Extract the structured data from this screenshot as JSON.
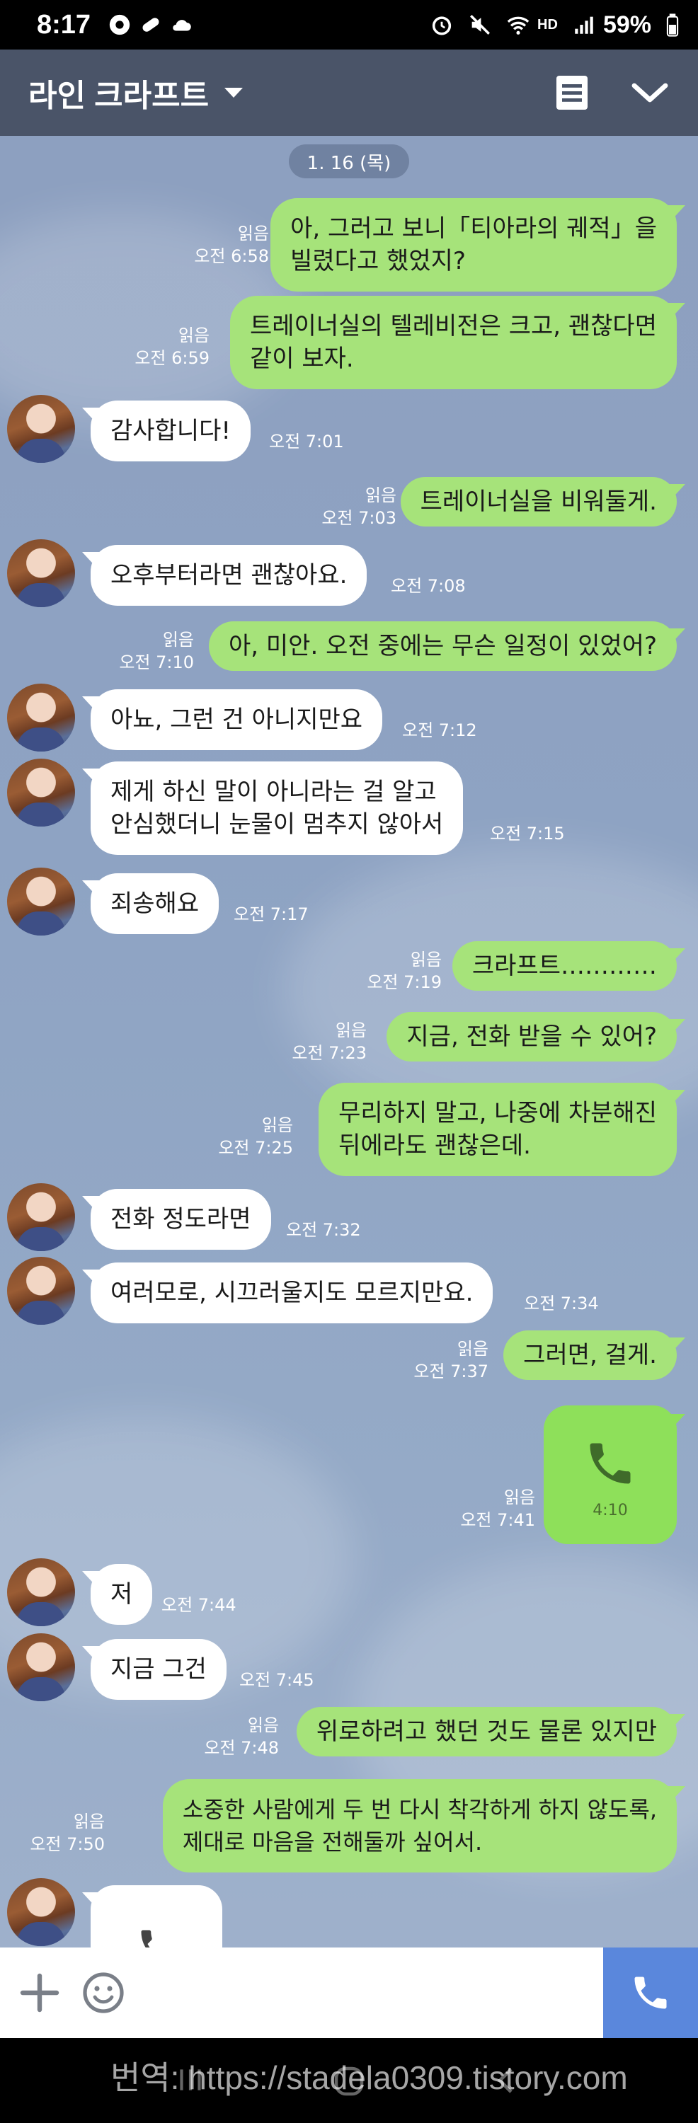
{
  "status_bar": {
    "time": "8:17",
    "battery": "59%",
    "hd_label": "HD"
  },
  "header": {
    "title": "라인 크라프트"
  },
  "date_pill": "1. 16 (목)",
  "messages": [
    {
      "side": "out",
      "lines": [
        "아, 그러고 보니「티아라의 궤적」을",
        "빌렸다고 했었지?"
      ],
      "read": "읽음",
      "time": "오전 6:58"
    },
    {
      "side": "out",
      "lines": [
        "트레이너실의 텔레비전은 크고, 괜찮다면",
        "같이 보자."
      ],
      "read": "읽음",
      "time": "오전 6:59"
    },
    {
      "side": "in",
      "lines": [
        "감사합니다!"
      ],
      "time": "오전 7:01"
    },
    {
      "side": "out",
      "lines": [
        "트레이너실을 비워둘게."
      ],
      "read": "읽음",
      "time": "오전 7:03"
    },
    {
      "side": "in",
      "lines": [
        "오후부터라면 괜찮아요."
      ],
      "time": "오전 7:08"
    },
    {
      "side": "out",
      "lines": [
        "아, 미안. 오전 중에는 무슨 일정이 있었어?"
      ],
      "read": "읽음",
      "time": "오전 7:10"
    },
    {
      "side": "in",
      "lines": [
        "아뇨, 그런 건 아니지만요"
      ],
      "time": "오전 7:12"
    },
    {
      "side": "in",
      "lines": [
        "제게 하신 말이 아니라는 걸 알고",
        "안심했더니 눈물이 멈추지 않아서"
      ],
      "time": "오전 7:15"
    },
    {
      "side": "in",
      "lines": [
        "죄송해요"
      ],
      "time": "오전 7:17"
    },
    {
      "side": "out",
      "lines": [
        "크라프트…………"
      ],
      "read": "읽음",
      "time": "오전 7:19"
    },
    {
      "side": "out",
      "lines": [
        "지금, 전화 받을 수 있어?"
      ],
      "read": "읽음",
      "time": "오전 7:23"
    },
    {
      "side": "out",
      "lines": [
        "무리하지 말고, 나중에 차분해진",
        "뒤에라도 괜찮은데."
      ],
      "read": "읽음",
      "time": "오전 7:25"
    },
    {
      "side": "in",
      "lines": [
        "전화 정도라면"
      ],
      "time": "오전 7:32"
    },
    {
      "side": "in",
      "lines": [
        "여러모로, 시끄러울지도 모르지만요."
      ],
      "time": "오전 7:34"
    },
    {
      "side": "out",
      "lines": [
        "그러면, 걸게."
      ],
      "read": "읽음",
      "time": "오전 7:37"
    },
    {
      "side": "out",
      "type": "call",
      "duration": "4:10",
      "read": "읽음",
      "time": "오전 7:41"
    },
    {
      "side": "in",
      "lines": [
        "저"
      ],
      "time": "오전 7:44"
    },
    {
      "side": "in",
      "lines": [
        "지금 그건"
      ],
      "time": "오전 7:45"
    },
    {
      "side": "out",
      "lines": [
        "위로하려고 했던 것도 물론 있지만"
      ],
      "read": "읽음",
      "time": "오전 7:48"
    },
    {
      "side": "out",
      "lines": [
        "소중한 사람에게 두 번 다시 착각하게 하지 않도록,",
        "제대로 마음을 전해둘까 싶어서."
      ],
      "read": "읽음",
      "time": "오전 7:50"
    }
  ],
  "input": {
    "placeholder": ""
  },
  "watermark": "번역: https://stadela0309.tistory.com",
  "colors": {
    "header": "#4a5468",
    "outgoing": "#a6e37a",
    "incoming": "#ffffff",
    "call_button": "#5a87dc",
    "background": "#8ea2c3"
  },
  "icons": {
    "menu": "notes-icon",
    "collapse": "chevron-down-icon",
    "add": "plus-icon",
    "emoji": "emoji-icon",
    "call": "phone-icon"
  }
}
